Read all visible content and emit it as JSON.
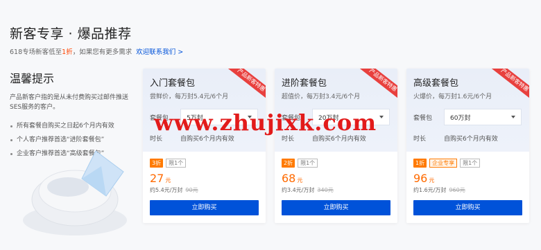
{
  "header": {
    "title": "新客专享 · 爆品推荐",
    "sub_pre": "618专场新客低至",
    "sub_hl": "1折",
    "sub_post": "，如果您有更多需求",
    "contact_link": "欢迎联系我们 >"
  },
  "tips": {
    "title": "温馨提示",
    "desc": "产品新客户指的是从未付费购买过邮件推送SES服务的客户。",
    "items": [
      "所有套餐自购买之日起6个月内有效",
      "个人客户推荐首选“进阶套餐包”",
      "企业客户推荐首选“高级套餐包”"
    ]
  },
  "ribbon": "产品新客特惠",
  "plans": [
    {
      "name": "入门套餐包",
      "tag": "尝鲜价，每万封5.4元/6个月",
      "pkg_label": "套餐包",
      "pkg_value": "5万封",
      "dur_label": "时长",
      "dur_value": "自购买6个月内有效",
      "discount": "3折",
      "special": "",
      "limit": "限1个",
      "price": "27",
      "price_unit": "元",
      "unit_price": "约5.4元/万封",
      "original": "90元",
      "buy_label": "立即购买"
    },
    {
      "name": "进阶套餐包",
      "tag": "超值价，每万封3.4元/6个月",
      "pkg_label": "套餐包",
      "pkg_value": "20万封",
      "dur_label": "时长",
      "dur_value": "自购买6个月内有效",
      "discount": "2折",
      "special": "",
      "limit": "限1个",
      "price": "68",
      "price_unit": "元",
      "unit_price": "约3.4元/万封",
      "original": "340元",
      "buy_label": "立即购买"
    },
    {
      "name": "高级套餐包",
      "tag": "火爆价，每万封1.6元/6个月",
      "pkg_label": "套餐包",
      "pkg_value": "60万封",
      "dur_label": "时长",
      "dur_value": "自购买6个月内有效",
      "discount": "1折",
      "special": "企业专享",
      "limit": "限1个",
      "price": "96",
      "price_unit": "元",
      "unit_price": "约1.6元/万封",
      "original": "960元",
      "buy_label": "立即购买"
    }
  ],
  "watermark": "www.zhujixk.com",
  "colors": {
    "accent": "#0052d9",
    "price": "#ff6a00",
    "ribbon": "#e8403e",
    "watermark": "#e21b1b"
  }
}
